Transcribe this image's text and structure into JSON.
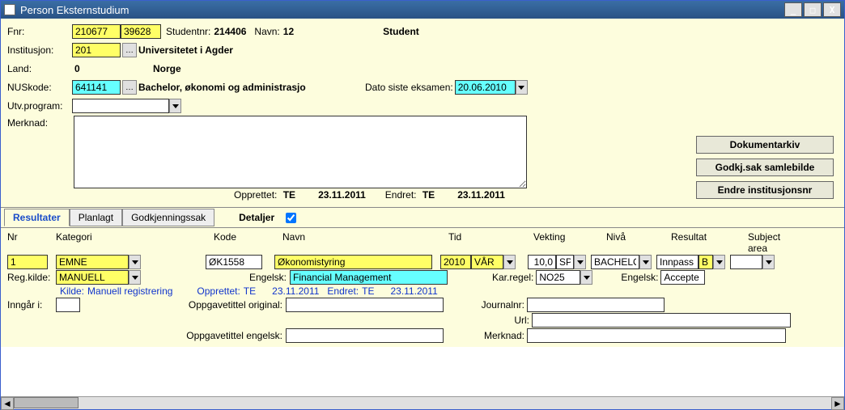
{
  "titlebar": {
    "title": "Person Eksternstudium"
  },
  "labels": {
    "fnr": "Fnr:",
    "studentnr": "Studentnr:",
    "navn": "Navn:",
    "institusjon": "Institusjon:",
    "land": "Land:",
    "nuskode": "NUSkode:",
    "utvprogram": "Utv.program:",
    "merknad": "Merknad:",
    "datoSisteEksamen": "Dato siste eksamen:",
    "opprettet": "Opprettet:",
    "endret": "Endret:",
    "kilde": "Kilde:",
    "regkilde": "Reg.kilde:",
    "inngar": "Inngår i:",
    "engelsk": "Engelsk:",
    "karregel": "Kar.regel:",
    "oppgOriginal": "Oppgavetittel original:",
    "oppgEngelsk": "Oppgavetittel engelsk:",
    "journalnr": "Journalnr:",
    "url": "Url:",
    "merknad2": "Merknad:"
  },
  "person": {
    "fnr1": "210677",
    "fnr2": "39628",
    "studentnr": "214406",
    "navnId": "12",
    "navnText": "Student",
    "instKode": "201",
    "instNavn": "Universitetet i Agder",
    "landKode": "0",
    "landNavn": "Norge",
    "nusKode": "641141",
    "nusNavn": "Bachelor, økonomi og administrasjo",
    "utvprogram": "",
    "merknad": "",
    "datoSisteEksamen": "20.06.2010"
  },
  "audit": {
    "opprettetBy": "TE",
    "opprettetDate": "23.11.2011",
    "endretBy": "TE",
    "endretDate": "23.11.2011"
  },
  "buttons": {
    "dokumentarkiv": "Dokumentarkiv",
    "godkjsak": "Godkj.sak samlebilde",
    "endreInst": "Endre institusjonsnr"
  },
  "tabs": {
    "resultater": "Resultater",
    "planlagt": "Planlagt",
    "godkjenningssak": "Godkjenningssak",
    "detaljer": "Detaljer"
  },
  "gridHeaders": {
    "nr": "Nr",
    "kategori": "Kategori",
    "kode": "Kode",
    "navn": "Navn",
    "tid": "Tid",
    "vekting": "Vekting",
    "niva": "Nivå",
    "resultat": "Resultat",
    "subject": "Subject area"
  },
  "row1": {
    "nr": "1",
    "kategori": "EMNE",
    "kode": "ØK1558",
    "navn": "Økonomistyring",
    "ar": "2010",
    "sem": "VÅR",
    "vekt": "10,0",
    "vektEnhet": "SP",
    "niva": "BACHELO",
    "res1": "Innpass",
    "res2": "B",
    "subject": ""
  },
  "row2": {
    "regkilde": "MANUELL",
    "kildeTekst": "Manuell registrering",
    "engelsk": "Financial Management",
    "karregel": "NO25",
    "engelsk2": "Accepte",
    "opprettetBy": "TE",
    "opprettetDate": "23.11.2011",
    "endretBy": "TE",
    "endretDate": "23.11.2011"
  }
}
